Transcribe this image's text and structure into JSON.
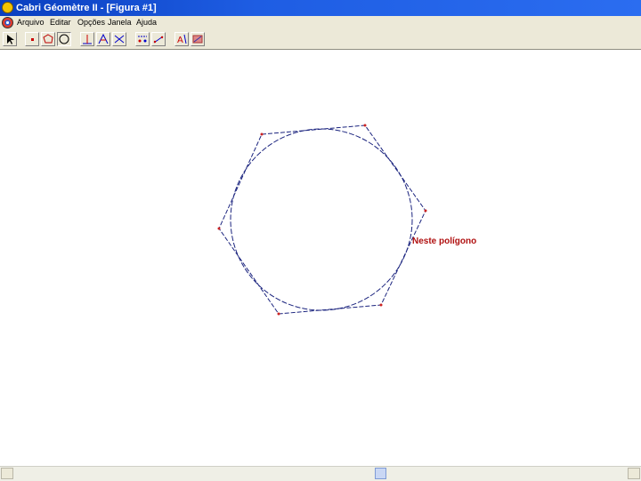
{
  "window": {
    "title": "Cabri Géomètre II - [Figura  #1]"
  },
  "menubar": {
    "items": [
      "Arquivo",
      "Editar",
      "Opções",
      "Janela",
      "Ajuda"
    ]
  },
  "toolbar": {
    "tools": [
      {
        "name": "pointer-tool-icon",
        "pressed": false
      },
      {
        "name": "point-tool-icon",
        "pressed": false
      },
      {
        "name": "polygon-tool-icon",
        "pressed": false
      },
      {
        "name": "circle-tool-icon",
        "pressed": true
      },
      {
        "name": "perpendicular-tool-icon",
        "pressed": false
      },
      {
        "name": "triangle-tool-icon",
        "pressed": false
      },
      {
        "name": "symmetry-tool-icon",
        "pressed": false
      },
      {
        "name": "point-on-object-tool-icon",
        "pressed": false
      },
      {
        "name": "measure-tool-icon",
        "pressed": false
      },
      {
        "name": "label-tool-icon",
        "pressed": false
      },
      {
        "name": "draw-tool-icon",
        "pressed": false
      }
    ]
  },
  "canvas": {
    "annotation": "Neste polígono",
    "colors": {
      "circle": "#1a237e",
      "polygon": "#1a237e",
      "vertex": "#cc2222",
      "annotation": "#b01010"
    }
  }
}
